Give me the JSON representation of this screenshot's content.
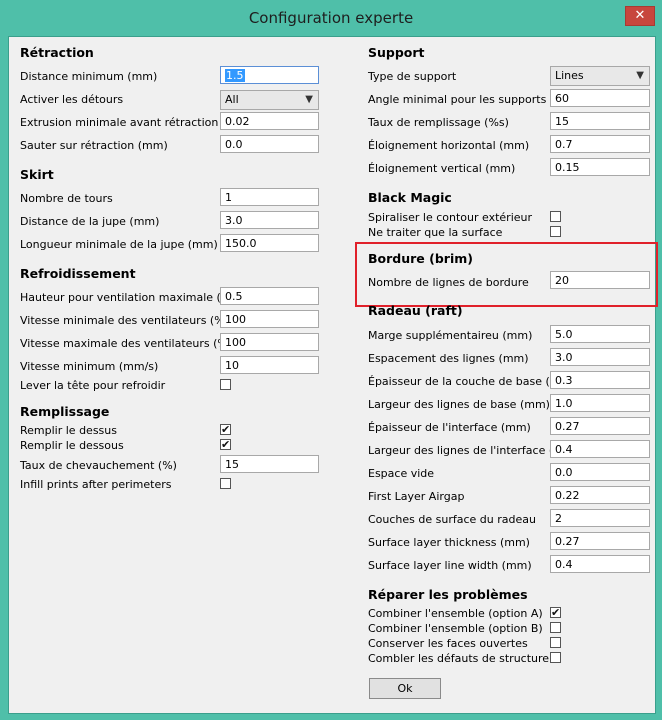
{
  "window": {
    "title": "Configuration experte",
    "close_glyph": "✕"
  },
  "retraction": {
    "header": "Rétraction",
    "min_distance": {
      "label": "Distance minimum (mm)",
      "value": "1.5"
    },
    "combing": {
      "label": "Activer les détours",
      "value": "All"
    },
    "min_extrusion": {
      "label": "Extrusion minimale avant rétraction (mm)",
      "value": "0.02"
    },
    "zhop": {
      "label": "Sauter sur rétraction (mm)",
      "value": "0.0"
    }
  },
  "skirt": {
    "header": "Skirt",
    "line_count": {
      "label": "Nombre de tours",
      "value": "1"
    },
    "distance": {
      "label": "Distance de la jupe (mm)",
      "value": "3.0"
    },
    "min_length": {
      "label": "Longueur minimale de la jupe (mm)",
      "value": "150.0"
    }
  },
  "cool": {
    "header": "Refroidissement",
    "fan_full_height": {
      "label": "Hauteur pour ventilation maximale (mm)",
      "value": "0.5"
    },
    "fan_min": {
      "label": "Vitesse minimale des ventilateurs (%)",
      "value": "100"
    },
    "fan_max": {
      "label": "Vitesse maximale des ventilateurs (%)",
      "value": "100"
    },
    "min_speed": {
      "label": "Vitesse minimum (mm/s)",
      "value": "10"
    },
    "head_lift": {
      "label": "Lever la tête pour refroidir",
      "checked": false
    }
  },
  "infill": {
    "header": "Remplissage",
    "top": {
      "label": "Remplir le dessus",
      "checked": true
    },
    "bottom": {
      "label": "Remplir le dessous",
      "checked": true
    },
    "overlap": {
      "label": "Taux de chevauchement (%)",
      "value": "15"
    },
    "after_perimeters": {
      "label": "Infill prints after perimeters",
      "checked": false
    }
  },
  "support": {
    "header": "Support",
    "type": {
      "label": "Type de support",
      "value": "Lines"
    },
    "angle": {
      "label": "Angle minimal pour les supports (deg)",
      "value": "60"
    },
    "fill_rate": {
      "label": "Taux de remplissage (%s)",
      "value": "15"
    },
    "xy_distance": {
      "label": "Éloignement horizontal (mm)",
      "value": "0.7"
    },
    "z_distance": {
      "label": "Éloignement vertical (mm)",
      "value": "0.15"
    }
  },
  "black_magic": {
    "header": "Black Magic",
    "spiralize": {
      "label": "Spiraliser le contour extérieur",
      "checked": false
    },
    "surface_only": {
      "label": "Ne traiter que la surface",
      "checked": false
    }
  },
  "brim": {
    "header": "Bordure (brim)",
    "line_count": {
      "label": "Nombre de lignes de bordure",
      "value": "20"
    }
  },
  "raft": {
    "header": "Radeau (raft)",
    "margin": {
      "label": "Marge supplémentaireu (mm)",
      "value": "5.0"
    },
    "line_spacing": {
      "label": "Espacement des lignes (mm)",
      "value": "3.0"
    },
    "base_thickness": {
      "label": "Épaisseur de la couche de base (mm)",
      "value": "0.3"
    },
    "base_width": {
      "label": "Largeur des lignes de base (mm)",
      "value": "1.0"
    },
    "interface_thickness": {
      "label": "Épaisseur de l'interface (mm)",
      "value": "0.27"
    },
    "interface_width": {
      "label": "Largeur des lignes de l'interface (mm)",
      "value": "0.4"
    },
    "airgap": {
      "label": "Espace vide",
      "value": "0.0"
    },
    "first_layer_airgap": {
      "label": "First Layer Airgap",
      "value": "0.22"
    },
    "surface_layers": {
      "label": "Couches de surface du radeau",
      "value": "2"
    },
    "surface_thickness": {
      "label": "Surface layer thickness (mm)",
      "value": "0.27"
    },
    "surface_width": {
      "label": "Surface layer line width (mm)",
      "value": "0.4"
    }
  },
  "fix": {
    "header": "Réparer les problèmes",
    "union_a": {
      "label": "Combiner l'ensemble (option A)",
      "checked": true
    },
    "union_b": {
      "label": "Combiner l'ensemble (option B)",
      "checked": false
    },
    "keep_open": {
      "label": "Conserver les faces ouvertes",
      "checked": false
    },
    "extensive_stitching": {
      "label": "Combler les défauts de structure",
      "checked": false
    }
  },
  "ok_button": "Ok",
  "check_glyph": "✔",
  "dropdown_glyph": "▼"
}
